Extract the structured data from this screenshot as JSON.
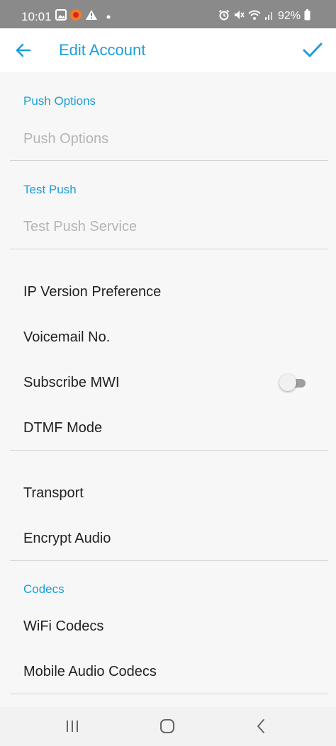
{
  "status_bar": {
    "time": "10:01",
    "battery": "92%",
    "left_icons": [
      "gallery-icon",
      "firefox-icon",
      "warning-icon",
      "dot-icon"
    ],
    "right_icons": [
      "alarm-icon",
      "mute-icon",
      "wifi-icon",
      "signal-icon",
      "battery-icon"
    ]
  },
  "app_bar": {
    "title": "Edit Account",
    "back_icon": "arrow-left-icon",
    "confirm_icon": "check-icon",
    "accent_color": "#1a9fd8"
  },
  "sections": {
    "push_options_header": "Push Options",
    "push_options_item": "Push Options",
    "test_push_header": "Test Push",
    "test_push_item": "Test Push Service",
    "ip_version": "IP Version Preference",
    "voicemail": "Voicemail No.",
    "subscribe_mwi": "Subscribe MWI",
    "subscribe_mwi_enabled": false,
    "dtmf_mode": "DTMF Mode",
    "transport": "Transport",
    "encrypt_audio": "Encrypt Audio",
    "codecs_header": "Codecs",
    "wifi_codecs": "WiFi Codecs",
    "mobile_codecs": "Mobile Audio Codecs"
  },
  "nav_bar": {
    "icons": [
      "recent-apps-icon",
      "home-icon",
      "back-icon"
    ]
  }
}
